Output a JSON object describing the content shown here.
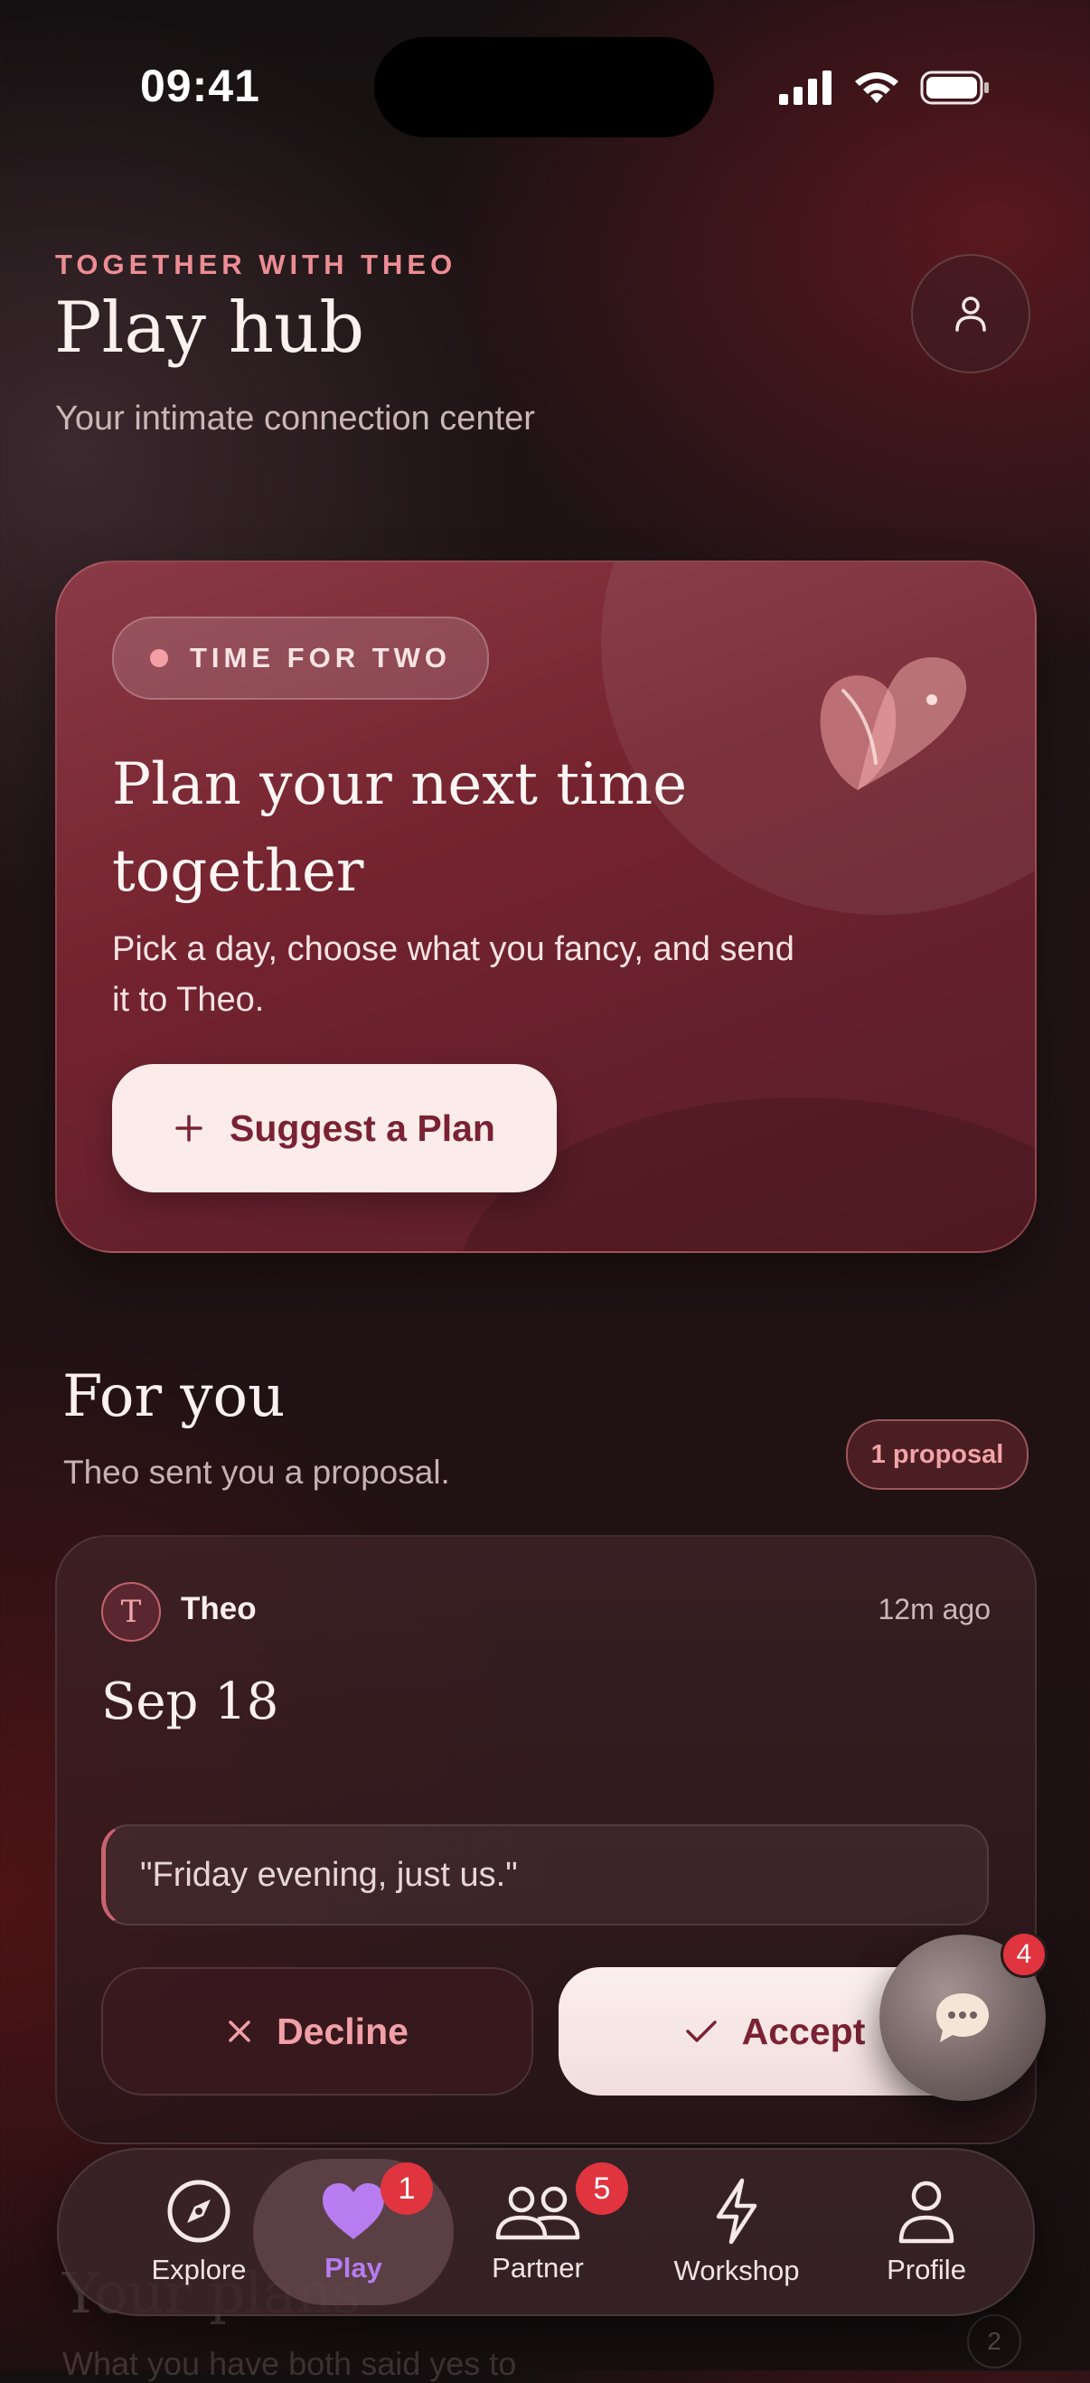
{
  "status_bar": {
    "time": "09:41"
  },
  "header": {
    "eyebrow": "TOGETHER WITH THEO",
    "title": "Play hub",
    "subtitle": "Your intimate connection center"
  },
  "hero": {
    "pill": "TIME FOR TWO",
    "heading": "Plan your next time together",
    "text": "Pick a day, choose what you fancy, and send it to Theo.",
    "button_label": "Suggest a Plan"
  },
  "for_you": {
    "title": "For you",
    "subtitle": "Theo sent you a proposal.",
    "badge": "1 proposal",
    "proposal": {
      "avatar_initial": "T",
      "sender": "Theo",
      "time_ago": "12m ago",
      "date": "Sep 18",
      "quote": "\"Friday evening, just us.\"",
      "decline_label": "Decline",
      "accept_label": "Accept"
    }
  },
  "chat_fab": {
    "badge": "4"
  },
  "your_plans": {
    "title": "Your plans",
    "subtitle": "What you have both said yes to",
    "count": "2"
  },
  "tab_bar": {
    "active": "Play",
    "tabs": [
      {
        "label": "Explore",
        "icon": "compass-icon"
      },
      {
        "label": "Play",
        "icon": "heart-icon",
        "badge": "1"
      },
      {
        "label": "Partner",
        "icon": "people-icon",
        "badge": "5"
      },
      {
        "label": "Workshop",
        "icon": "bolt-icon"
      },
      {
        "label": "Profile",
        "icon": "person-icon"
      }
    ]
  },
  "colors": {
    "accent": "#ec8d93",
    "hero_bg": "#74232f",
    "button_bg": "#fbecea",
    "button_text": "#7a2233",
    "badge_red": "#e0343f",
    "active_tab": "#b67cf0"
  }
}
